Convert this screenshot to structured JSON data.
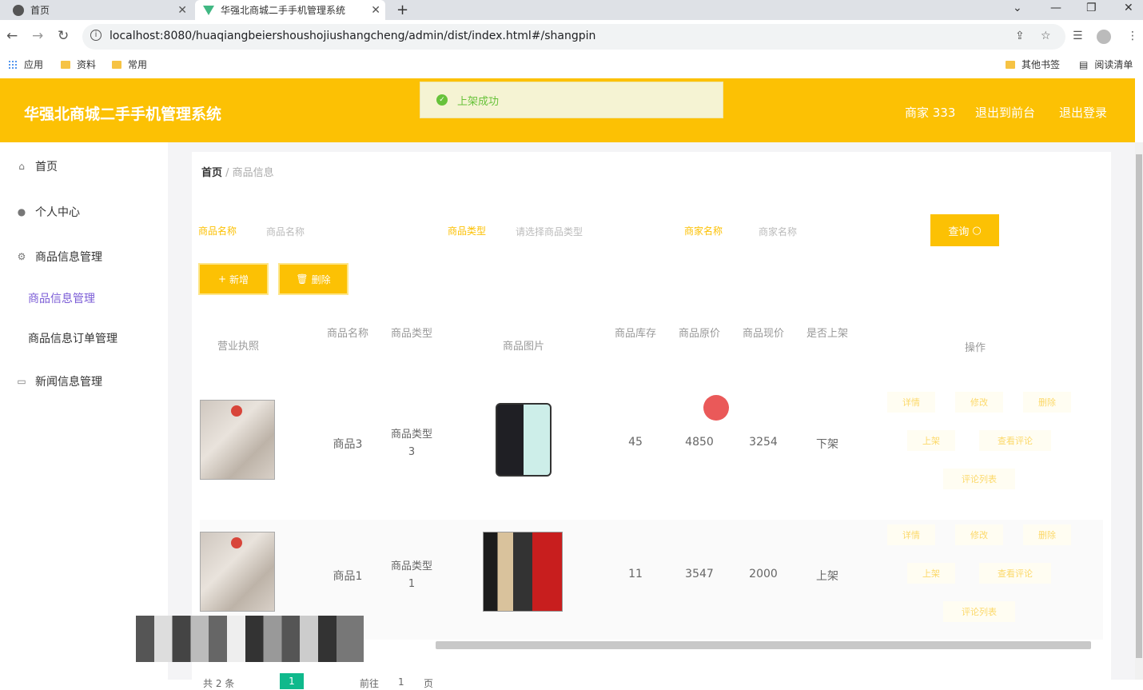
{
  "browser": {
    "tabs": [
      {
        "label": "首页"
      },
      {
        "label": "华强北商城二手手机管理系统"
      }
    ],
    "url": "localhost:8080/huaqiangbeiershoushojiushangcheng/admin/dist/index.html#/shangpin",
    "bookmarks": [
      "应用",
      "资料",
      "常用"
    ],
    "bookmarks_right": [
      "其他书签",
      "阅读清单"
    ]
  },
  "header": {
    "title": "华强北商城二手手机管理系统",
    "user": "商家 333",
    "back_label": "退出到前台",
    "logout_label": "退出登录"
  },
  "toast": {
    "message": "上架成功"
  },
  "sidebar": {
    "items": [
      {
        "label": "首页"
      },
      {
        "label": "个人中心"
      },
      {
        "label": "商品信息管理"
      },
      {
        "label": "商品信息管理"
      },
      {
        "label": "商品信息订单管理"
      },
      {
        "label": "新闻信息管理"
      }
    ]
  },
  "breadcrumb": {
    "home": "首页",
    "current": "商品信息"
  },
  "filters": [
    {
      "label": "商品名称",
      "placeholder": "商品名称"
    },
    {
      "label": "商品类型",
      "placeholder": "请选择商品类型"
    },
    {
      "label": "商家名称",
      "placeholder": "商家名称"
    }
  ],
  "buttons": {
    "query": "查询",
    "add": "新增",
    "delete": "删除"
  },
  "table": {
    "columns": [
      "营业执照",
      "商品名称",
      "商品类型",
      "商品图片",
      "商品库存",
      "商品原价",
      "商品现价",
      "是否上架",
      "操作"
    ],
    "rows": [
      {
        "name": "商品3",
        "type_line1": "商品类型",
        "type_line2": "3",
        "stock": "45",
        "orig": "4850",
        "price": "3254",
        "status": "下架"
      },
      {
        "name": "商品1",
        "type_line1": "商品类型",
        "type_line2": "1",
        "stock": "11",
        "orig": "3547",
        "price": "2000",
        "status": "上架"
      }
    ],
    "ops": [
      "详情",
      "修改",
      "删除",
      "上架",
      "查看评论",
      "评论列表"
    ]
  },
  "pager": {
    "total": "共 2 条",
    "page": "1",
    "goto": "前往",
    "goto_val": "1",
    "page_unit": "页"
  }
}
